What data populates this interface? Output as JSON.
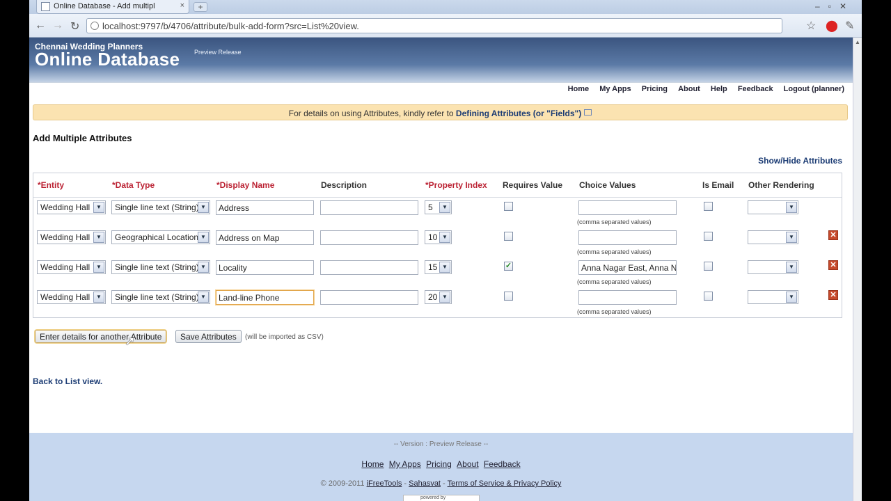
{
  "browser": {
    "tab_title": "Online Database - Add multipl",
    "tab_close": "×",
    "new_tab": "+",
    "window_controls": "–▫✕",
    "url": "localhost:9797/b/4706/attribute/bulk-add-form?src=List%20view.",
    "icons": [
      "back-arrow-icon",
      "forward-arrow-icon",
      "reload-icon",
      "star-icon",
      "stop-icon",
      "wrench-icon"
    ]
  },
  "banner": {
    "org": "Chennai Wedding Planners",
    "title": "Online Database",
    "badge": "Preview Release"
  },
  "nav": {
    "items": [
      "Home",
      "My Apps",
      "Pricing",
      "About",
      "Help",
      "Feedback",
      "Logout (planner)"
    ]
  },
  "notice": {
    "text": "For details on using Attributes, kindly refer to ",
    "link": "Defining Attributes (or \"Fields\")"
  },
  "heading": "Add Multiple Attributes",
  "show_hide": "Show/Hide Attributes",
  "table": {
    "headers": {
      "entity": "*Entity",
      "data_type": "*Data Type",
      "display_name": "*Display Name",
      "description": "Description",
      "property_index": "*Property Index",
      "requires_value": "Requires Value",
      "choice_values": "Choice Values",
      "is_email": "Is Email",
      "other_rendering": "Other Rendering"
    },
    "choice_hint": "(comma separated values)",
    "rows": [
      {
        "entity": "Wedding Hall",
        "data_type": "Single line text (String)",
        "display_name": "Address",
        "description": "",
        "property_index": "5",
        "requires_value": "",
        "choice_values": "",
        "is_email": "",
        "other_rendering": ""
      },
      {
        "entity": "Wedding Hall",
        "data_type": "Geographical Location",
        "display_name": "Address on Map",
        "description": "",
        "property_index": "10",
        "requires_value": "",
        "choice_values": "",
        "is_email": "",
        "other_rendering": ""
      },
      {
        "entity": "Wedding Hall",
        "data_type": "Single line text (String)",
        "display_name": "Locality",
        "description": "",
        "property_index": "15",
        "requires_value": "✓",
        "choice_values": "Anna Nagar East, Anna Nagar West",
        "is_email": "",
        "other_rendering": ""
      },
      {
        "entity": "Wedding Hall",
        "data_type": "Single line text (String)",
        "display_name": "Land-line Phone",
        "description": "",
        "property_index": "20",
        "requires_value": "",
        "choice_values": "",
        "is_email": "",
        "other_rendering": ""
      }
    ]
  },
  "buttons": {
    "add_another": "Enter details for another Attribute",
    "save": "Save Attributes",
    "csv_note": "(will be imported as CSV)"
  },
  "back_link": "Back to List view.",
  "footer": {
    "version": "-- Version : Preview Release --",
    "links": [
      "Home",
      "My Apps",
      "Pricing",
      "About",
      "Feedback"
    ],
    "copyright": "© 2009-2011",
    "brand1": "iFreeTools",
    "brand2": "Sahasvat",
    "terms": "Terms of Service & Privacy Policy",
    "powered": "powered by"
  }
}
